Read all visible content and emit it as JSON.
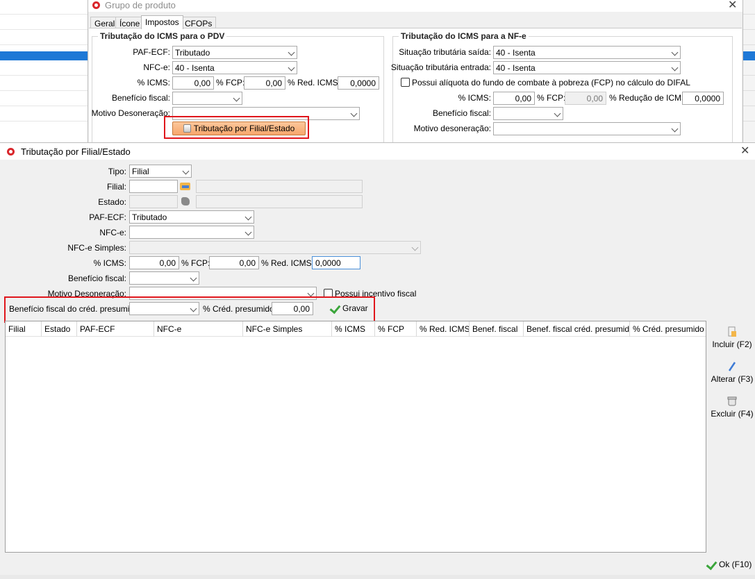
{
  "back_window": {
    "title": "Grupo de produto",
    "tabs": [
      "Geral",
      "Ícone",
      "Impostos",
      "CFOPs"
    ],
    "pdv_group": {
      "title": "Tributação do ICMS para o PDV",
      "paf_ecf_label": "PAF-ECF:",
      "paf_ecf_value": "Tributado",
      "nfce_label": "NFC-e:",
      "nfce_value": "40 - Isenta",
      "icms_label": "% ICMS:",
      "icms_value": "0,00",
      "fcp_label": "% FCP:",
      "fcp_value": "0,00",
      "red_icms_label": "% Red. ICMS:",
      "red_icms_value": "0,0000",
      "beneficio_label": "Benefício fiscal:",
      "motivo_label": "Motivo Desoneração:",
      "tribut_button": "Tributação por Filial/Estado"
    },
    "nfe_group": {
      "title": "Tributação do ICMS para a NF-e",
      "saida_label": "Situação tributária saída:",
      "saida_value": "40 - Isenta",
      "entrada_label": "Situação tributária entrada:",
      "entrada_value": "40 - Isenta",
      "fcp_difal_label": "Possui alíquota do fundo de combate à pobreza (FCP) no cálculo do DIFAL",
      "icms_label": "% ICMS:",
      "icms_value": "0,00",
      "fcp_label": "% FCP:",
      "fcp_value": "0,00",
      "red_label": "% Redução de ICMS:",
      "red_value": "0,0000",
      "beneficio_label": "Benefício fiscal:",
      "motivo_label": "Motivo desoneração:"
    }
  },
  "front_window": {
    "title": "Tributação por Filial/Estado",
    "form": {
      "tipo_label": "Tipo:",
      "tipo_value": "Filial",
      "filial_label": "Filial:",
      "estado_label": "Estado:",
      "paf_ecf_label": "PAF-ECF:",
      "paf_ecf_value": "Tributado",
      "nfce_label": "NFC-e:",
      "nfce_simples_label": "NFC-e Simples:",
      "icms_label": "% ICMS:",
      "icms_value": "0,00",
      "fcp_label": "% FCP:",
      "fcp_value": "0,00",
      "red_icms_label": "% Red. ICMS:",
      "red_icms_value": "0,0000",
      "beneficio_label": "Benefício fiscal:",
      "motivo_label": "Motivo Desoneração:",
      "incentivo_label": "Possui incentivo fiscal",
      "benef_cred_label": "Benefício fiscal do créd. presumido:",
      "cred_presumido_label": "% Créd. presumido:",
      "cred_presumido_value": "0,00",
      "gravar_label": "Gravar"
    },
    "grid_columns": [
      "Filial",
      "Estado",
      "PAF-ECF",
      "NFC-e",
      "NFC-e Simples",
      "% ICMS",
      "% FCP",
      "% Red. ICMS",
      "Benef. fiscal",
      "Benef. fiscal créd. presumido",
      "% Créd. presumido"
    ],
    "side_buttons": {
      "incluir": "Incluir (F2)",
      "alterar": "Alterar (F3)",
      "excluir": "Excluir (F4)"
    },
    "ok_label": "Ok (F10)"
  },
  "colors": {
    "highlight_box": "#e0161c",
    "selection_row": "#1e78d6",
    "orange_button": "#f7a66b"
  }
}
